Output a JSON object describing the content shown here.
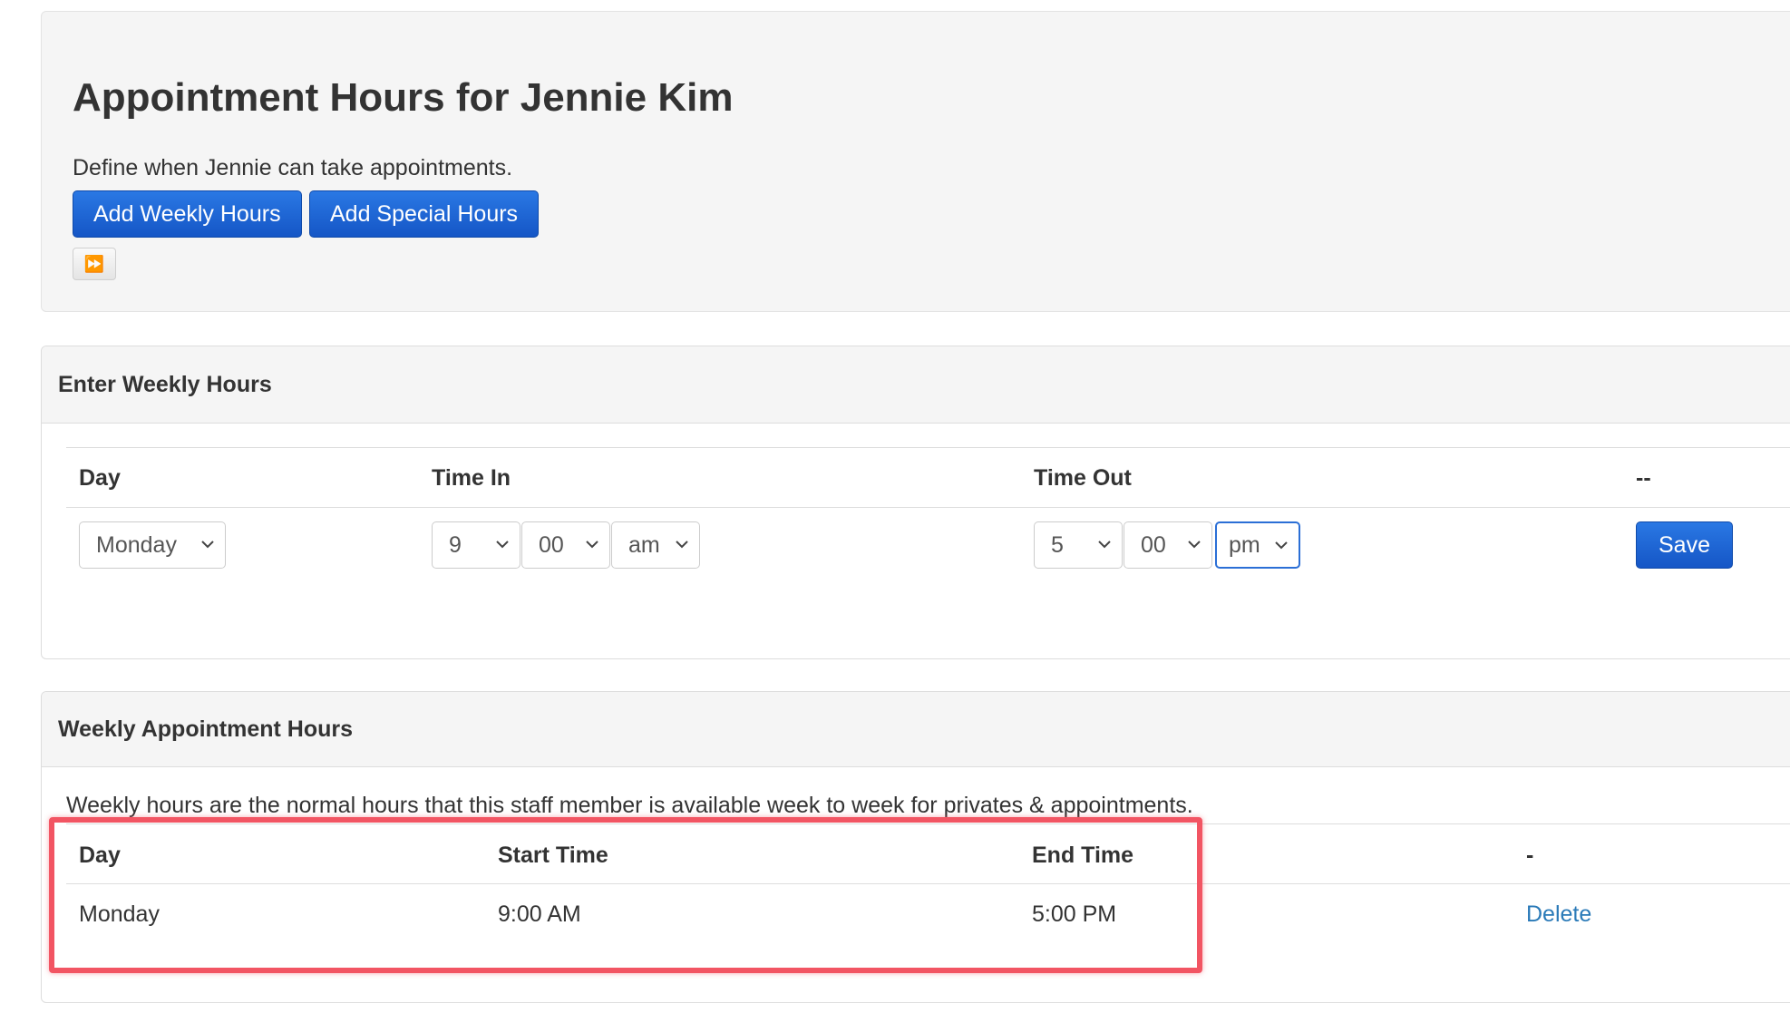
{
  "header": {
    "title": "Appointment Hours for Jennie Kim",
    "subtitle": "Define when Jennie can take appointments.",
    "add_weekly_label": "Add Weekly Hours",
    "add_special_label": "Add Special Hours",
    "fast_forward_icon": "fast-forward-icon"
  },
  "enter_weekly": {
    "heading": "Enter Weekly Hours",
    "columns": [
      "Day",
      "Time In",
      "Time Out",
      "--"
    ],
    "day_value": "Monday",
    "time_in": {
      "hour": "9",
      "minute": "00",
      "ampm": "am"
    },
    "time_out": {
      "hour": "5",
      "minute": "00",
      "ampm": "pm"
    },
    "save_label": "Save"
  },
  "weekly_hours": {
    "heading": "Weekly Appointment Hours",
    "description": "Weekly hours are the normal hours that this staff member is available week to week for privates & appointments.",
    "columns": [
      "Day",
      "Start Time",
      "End Time",
      "-"
    ],
    "rows": [
      {
        "day": "Monday",
        "start": "9:00 AM",
        "end": "5:00 PM",
        "action": "Delete"
      }
    ]
  },
  "colors": {
    "primary": "#1b62d2",
    "link": "#2a7ab8",
    "highlight": "#f25563"
  }
}
